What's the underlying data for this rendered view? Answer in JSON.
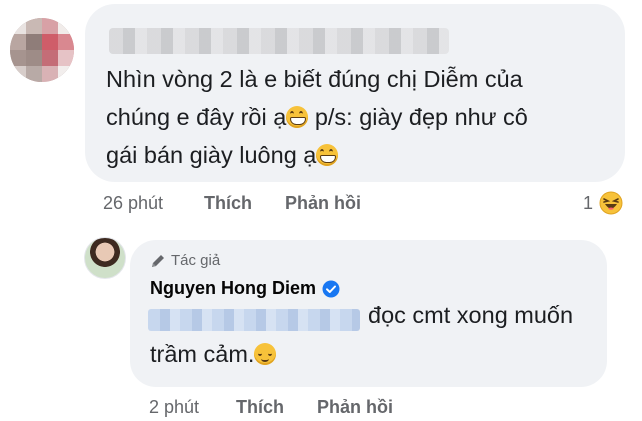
{
  "comment": {
    "text_line1": "Nhìn vòng 2 là e biết đúng chị Diễm của",
    "text_line2_a": "chúng e đây rồi ạ",
    "text_line2_b": " p/s: giày đẹp như cô",
    "text_line3": "gái bán giày luông ạ",
    "emoji": "grinning-face-icon",
    "time": "26 phút",
    "like_label": "Thích",
    "reply_label": "Phản hồi",
    "reaction_count": "1",
    "reaction_icon": "haha-reaction-icon"
  },
  "reply": {
    "badge_label": "Tác giả",
    "badge_icon": "pencil-icon",
    "author": "Nguyen Hong Diem",
    "verified_icon": "verified-badge-icon",
    "text_line1": "đọc cmt xong muốn",
    "text_line2": "trầm cảm.",
    "emoji": "relieved-face-icon",
    "time": "2 phút",
    "like_label": "Thích",
    "reply_label": "Phản hồi"
  },
  "colors": {
    "bubble": "#f0f2f5",
    "text": "#1c1e21",
    "secondary": "#65676b",
    "verified": "#1877f2"
  }
}
